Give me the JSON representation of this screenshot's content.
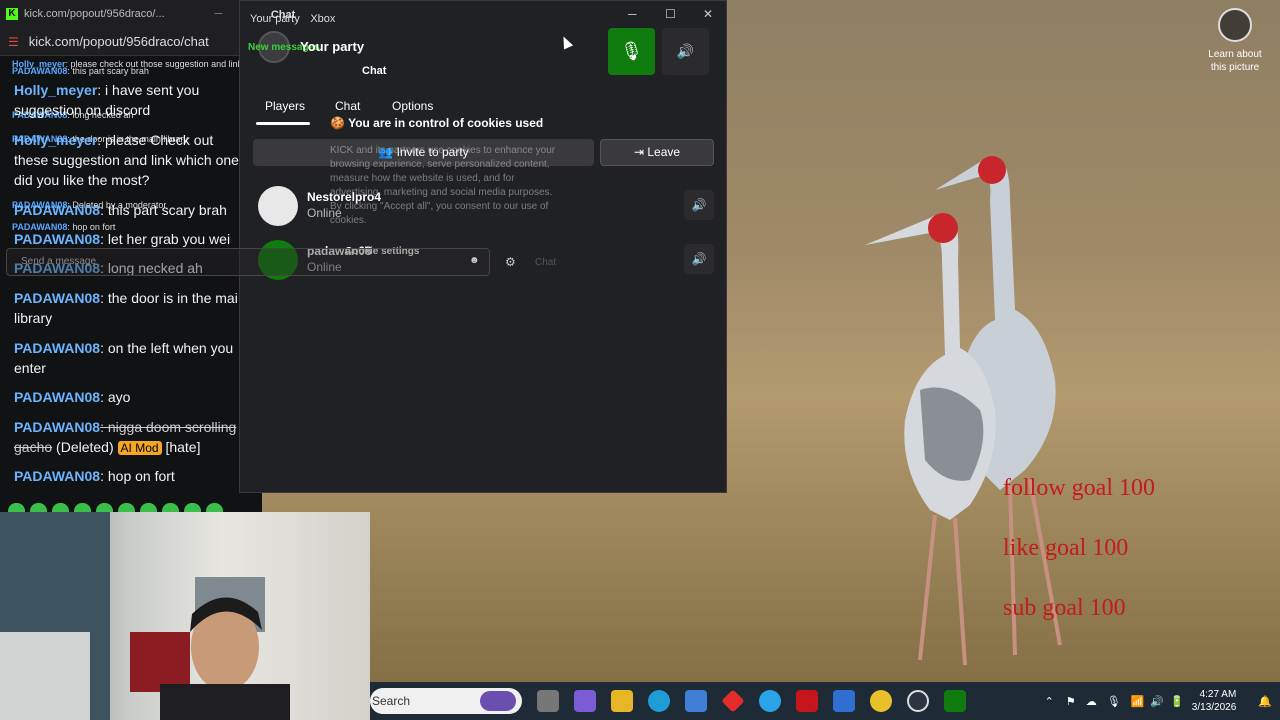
{
  "kick": {
    "title_url": "kick.com/popout/956draco/...",
    "url": "kick.com/popout/956draco/chat",
    "chat_header": "Chat",
    "small_messages": [
      {
        "user": "Holly_meyer",
        "text": ": please check out those suggestion and link which one did you like the most?"
      },
      {
        "user": "PADAWAN08",
        "text": ": this part scary brah"
      },
      {
        "user": "Holly_meyer",
        "text": ": i have sent you suggestion on discord"
      },
      {
        "user": "PADAWAN08",
        "text": ": long necked ah"
      },
      {
        "user": "PADAWAN08",
        "text": ": the door is in the main library"
      },
      {
        "user": "PADAWAN08",
        "text": ": on the left when you enter"
      },
      {
        "user": "PADAWAN08",
        "text": ": ayo"
      },
      {
        "user": "PADAWAN08",
        "text": ": Deleted by a moderator"
      },
      {
        "user": "PADAWAN08",
        "text": ": hop on fort"
      }
    ],
    "messages": [
      {
        "user": "Holly_meyer",
        "text": ": i have sent you suggestion on discord"
      },
      {
        "user": "Holly_meyer",
        "text": ": please Check out these suggestion and link which one did you like the most?"
      },
      {
        "user": "PADAWAN08",
        "text": ": this part scary brah"
      },
      {
        "user": "PADAWAN08",
        "text": ": let her grab you wei"
      },
      {
        "user": "PADAWAN08",
        "text": ": long necked ah"
      },
      {
        "user": "PADAWAN08",
        "text": ": the door is in the mai library"
      },
      {
        "user": "PADAWAN08",
        "text": ": on the left when you enter"
      },
      {
        "user": "PADAWAN08",
        "text": ": ayo"
      },
      {
        "user": "PADAWAN08",
        "text": ": nigga doom scrolling gacho",
        "deleted_label": "(Deleted)",
        "badge": "AI Mod",
        "tag": "[hate]"
      },
      {
        "user": "PADAWAN08",
        "text": ": hop on fort"
      }
    ],
    "send_placeholder": "Send a message",
    "chat_button": "Chat"
  },
  "xbox": {
    "window_title_prefix": "Your party",
    "window_title_chat": "Chat",
    "window_title_app": "Xbox",
    "new_messages": "New messages",
    "party_label": "Your party",
    "tabs": [
      "Players",
      "Chat",
      "Options"
    ],
    "invite_label": "Invite to party",
    "leave_label": "Leave",
    "players": [
      {
        "name": "Nestorelpro4",
        "status": "Online"
      },
      {
        "name": "padawan08",
        "status": "Online"
      }
    ]
  },
  "cookie": {
    "title": "You are in control of cookies used",
    "body": "KICK and its partners use cookies to enhance your browsing experience, serve personalized content, measure how the website is used, and for advertising, marketing and social media purposes. By clicking \"Accept all\", you consent to our use of cookies.",
    "settings": "Cookie settings"
  },
  "desktop": {
    "learn_label": "Learn about this picture",
    "goals": [
      "follow goal 100",
      "like goal 100",
      "sub goal 100"
    ],
    "goal_color": "#c31c1c"
  },
  "taskbar": {
    "search_placeholder": "Search",
    "time": "4:27 AM",
    "date": "3/13/2026"
  }
}
